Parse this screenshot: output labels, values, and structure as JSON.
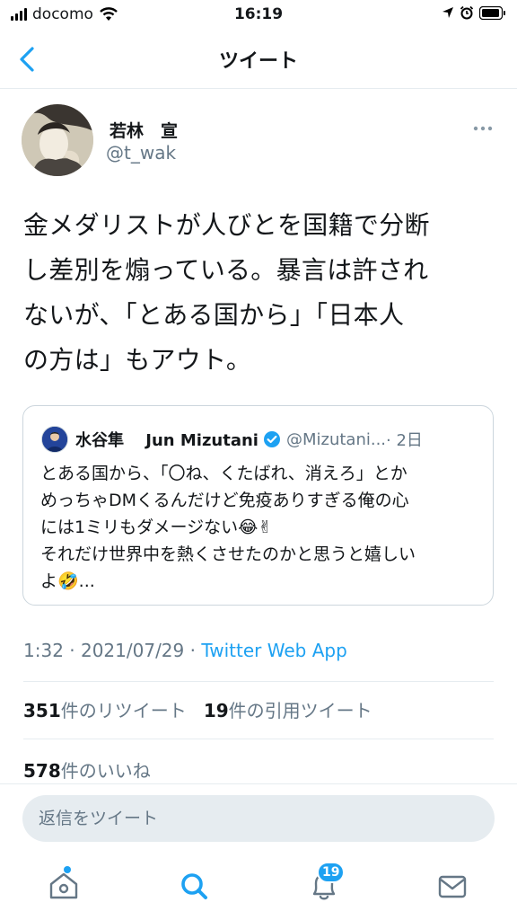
{
  "status_bar": {
    "carrier": "docomo",
    "time": "16:19"
  },
  "nav": {
    "title": "ツイート"
  },
  "tweet": {
    "display_name": "若林　宣",
    "handle": "@t_wak",
    "text_lines": [
      "金メダリストが人びとを国籍で分断",
      "し差別を煽っている。暴言は許され",
      "ないが、「とある国から」「日本人",
      "の方は」もアウト。"
    ],
    "timestamp": "1:32 · 2021/07/29 · ",
    "source": "Twitter Web App",
    "retweets_count": "351",
    "retweets_label": "件のリツイート",
    "quotes_count": "19",
    "quotes_label": "件の引用ツイート",
    "likes_count": "578",
    "likes_label": "件のいいね"
  },
  "quoted_tweet": {
    "display_name": "水谷隼　 Jun Mizutani",
    "handle": "@Mizutani...",
    "age": " · 2日",
    "text_lines": [
      "とある国から、「〇ね、くたばれ、消えろ」とか",
      "めっちゃDMくるんだけど免疫ありすぎる俺の心",
      "には1ミリもダメージない😂✌",
      "それだけ世界中を熱くさせたのかと思うと嬉しい",
      "よ🤣..."
    ]
  },
  "reply": {
    "placeholder": "返信をツイート"
  },
  "tab_bar": {
    "notifications_badge": "19"
  },
  "colors": {
    "accent": "#1da1f2",
    "secondary_text": "#657786",
    "border": "#e6ecf0"
  },
  "icons": [
    "back-chevron-icon",
    "more-icon",
    "verified-icon",
    "home-icon",
    "search-icon",
    "bell-icon",
    "mail-icon",
    "wifi-icon",
    "battery-icon",
    "location-icon",
    "alarm-icon"
  ]
}
